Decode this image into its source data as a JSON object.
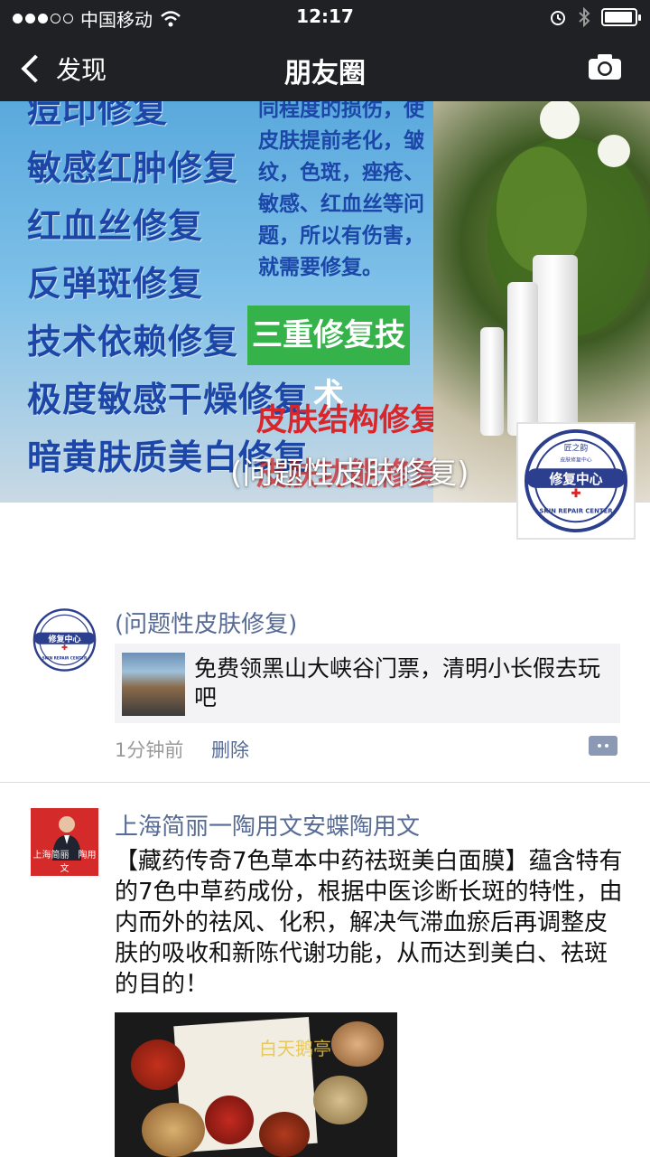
{
  "status_bar": {
    "carrier": "中国移动",
    "time": "12:17"
  },
  "nav": {
    "back_label": "发现",
    "title": "朋友圈"
  },
  "cover": {
    "left_items": [
      "痘印修复",
      "敏感红肿修复",
      "红血丝修复",
      "反弹斑修复",
      "技术依赖修复",
      "极度敏感干燥修复",
      "暗黄肤质美白修复"
    ],
    "paragraph_lines": [
      "同程度的损伤，使",
      "皮肤提前老化，皱",
      "纹，色斑，痤疮、",
      "敏感、红血丝等问",
      "题，所以有伤害，",
      "就需要修复。"
    ],
    "green_banner": "三重修复技术",
    "red_line_1": "皮肤结构修复",
    "red_line_2": "皮肤功能修复",
    "profile_name": "(问题性皮肤修复)"
  },
  "logo": {
    "top_text": "匠之韵",
    "sub_text": "皮肤修复中心",
    "center_text": "修复中心",
    "ring_text": "SKIN REPAIR CENTER"
  },
  "posts": [
    {
      "author": "(问题性皮肤修复)",
      "link_title": "免费领黑山大峡谷门票，清明小长假去玩吧",
      "time": "1分钟前",
      "delete_label": "删除"
    },
    {
      "author": "上海简丽一陶用文安蝶陶用文",
      "avatar_caption": "上海简丽　陶用文",
      "text": "【藏药传奇7色草本中药祛斑美白面膜】蕴含特有的7色中草药成份，根据中医诊断长斑的特性，由内而外的祛风、化积，解决气滞血瘀后再调整皮肤的吸收和新陈代谢功能，从而达到美白、祛斑的目的！",
      "image_watermark": "白天鹅亭"
    }
  ],
  "colors": {
    "nav_bg": "#1f2124",
    "link_blue": "#576b95",
    "meta_gray": "#9a9a9a",
    "card_bg": "#f3f3f5"
  }
}
